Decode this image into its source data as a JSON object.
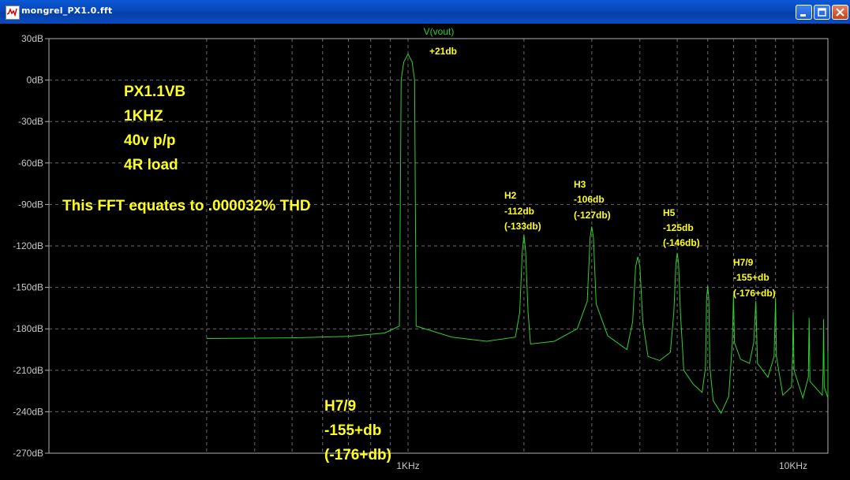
{
  "window": {
    "title": "mongrel_PX1.0.fft",
    "icon": "waveform-icon",
    "buttons": [
      "minimize-icon",
      "maximize-icon",
      "close-icon"
    ]
  },
  "plot": {
    "trace_name": "V(vout)",
    "trace_color": "#2fd12f",
    "background": "#000000",
    "grid_color": "#6a6a6a",
    "text_color": "#ffff1e",
    "y_tick_labels": [
      "30dB",
      "0dB",
      "-30dB",
      "-60dB",
      "-90dB",
      "-120dB",
      "-150dB",
      "-180dB",
      "-210dB",
      "-240dB",
      "-270dB"
    ],
    "x_tick_labels": [
      "1KHz",
      "10KHz"
    ]
  },
  "annotations": {
    "peak_label": "+21db",
    "info_lines": [
      "PX1.1VB",
      "1KHZ",
      "40v p/p",
      "4R load"
    ],
    "thd_note": "This FFT equates to .000032% THD",
    "h2": [
      "H2",
      "-112db",
      "(-133db)"
    ],
    "h3": [
      "H3",
      "-106db",
      "(-127db)"
    ],
    "h5": [
      "H5",
      "-125db",
      "(-146db)"
    ],
    "h79": [
      "H7/9",
      "-155+db",
      "(-176+db)"
    ],
    "h79_large": [
      "H7/9",
      "-155+db",
      "(-176+db)"
    ]
  },
  "chart_data": {
    "type": "line",
    "xscale": "log",
    "xlim": [
      300,
      13000
    ],
    "ylim": [
      -270,
      30
    ],
    "ylabel": "",
    "xlabel": "",
    "grid": true,
    "series": [
      {
        "name": "V(vout)",
        "points": [
          [
            300,
            -187
          ],
          [
            500,
            -186.5
          ],
          [
            700,
            -185.5
          ],
          [
            870,
            -183
          ],
          [
            950,
            -178
          ],
          [
            960,
            0
          ],
          [
            975,
            13
          ],
          [
            1000,
            19
          ],
          [
            1025,
            13
          ],
          [
            1040,
            0
          ],
          [
            1050,
            -178
          ],
          [
            1300,
            -186
          ],
          [
            1600,
            -189
          ],
          [
            1900,
            -186
          ],
          [
            1950,
            -168
          ],
          [
            1980,
            -124
          ],
          [
            2000,
            -112
          ],
          [
            2020,
            -124
          ],
          [
            2050,
            -168
          ],
          [
            2080,
            -191
          ],
          [
            2400,
            -189
          ],
          [
            2750,
            -180
          ],
          [
            2920,
            -160
          ],
          [
            2970,
            -114
          ],
          [
            3000,
            -106
          ],
          [
            3030,
            -114
          ],
          [
            3080,
            -162
          ],
          [
            3300,
            -185
          ],
          [
            3700,
            -195
          ],
          [
            3830,
            -175
          ],
          [
            3900,
            -135
          ],
          [
            3950,
            -128
          ],
          [
            4000,
            -135
          ],
          [
            4070,
            -175
          ],
          [
            4200,
            -200
          ],
          [
            4500,
            -203
          ],
          [
            4800,
            -197
          ],
          [
            4900,
            -168
          ],
          [
            4960,
            -133
          ],
          [
            5000,
            -125
          ],
          [
            5040,
            -133
          ],
          [
            5100,
            -170
          ],
          [
            5200,
            -210
          ],
          [
            5500,
            -220
          ],
          [
            5800,
            -226
          ],
          [
            5920,
            -208
          ],
          [
            5960,
            -158
          ],
          [
            6000,
            -149
          ],
          [
            6040,
            -158
          ],
          [
            6080,
            -208
          ],
          [
            6200,
            -232
          ],
          [
            6500,
            -241
          ],
          [
            6800,
            -229
          ],
          [
            6950,
            -190
          ],
          [
            7000,
            -155
          ],
          [
            7040,
            -190
          ],
          [
            7300,
            -202
          ],
          [
            7700,
            -205
          ],
          [
            7900,
            -190
          ],
          [
            8000,
            -160
          ],
          [
            8080,
            -205
          ],
          [
            8600,
            -215
          ],
          [
            8920,
            -200
          ],
          [
            9000,
            -158
          ],
          [
            9050,
            -200
          ],
          [
            9400,
            -228
          ],
          [
            9900,
            -222
          ],
          [
            9960,
            -200
          ],
          [
            10000,
            -168
          ],
          [
            10050,
            -210
          ],
          [
            10600,
            -230
          ],
          [
            10950,
            -215
          ],
          [
            11000,
            -172
          ],
          [
            11050,
            -218
          ],
          [
            11900,
            -228
          ],
          [
            11960,
            -210
          ],
          [
            12000,
            -173
          ],
          [
            12040,
            -222
          ],
          [
            12400,
            -230
          ],
          [
            12480,
            -216
          ],
          [
            12500,
            -196
          ]
        ]
      }
    ]
  }
}
